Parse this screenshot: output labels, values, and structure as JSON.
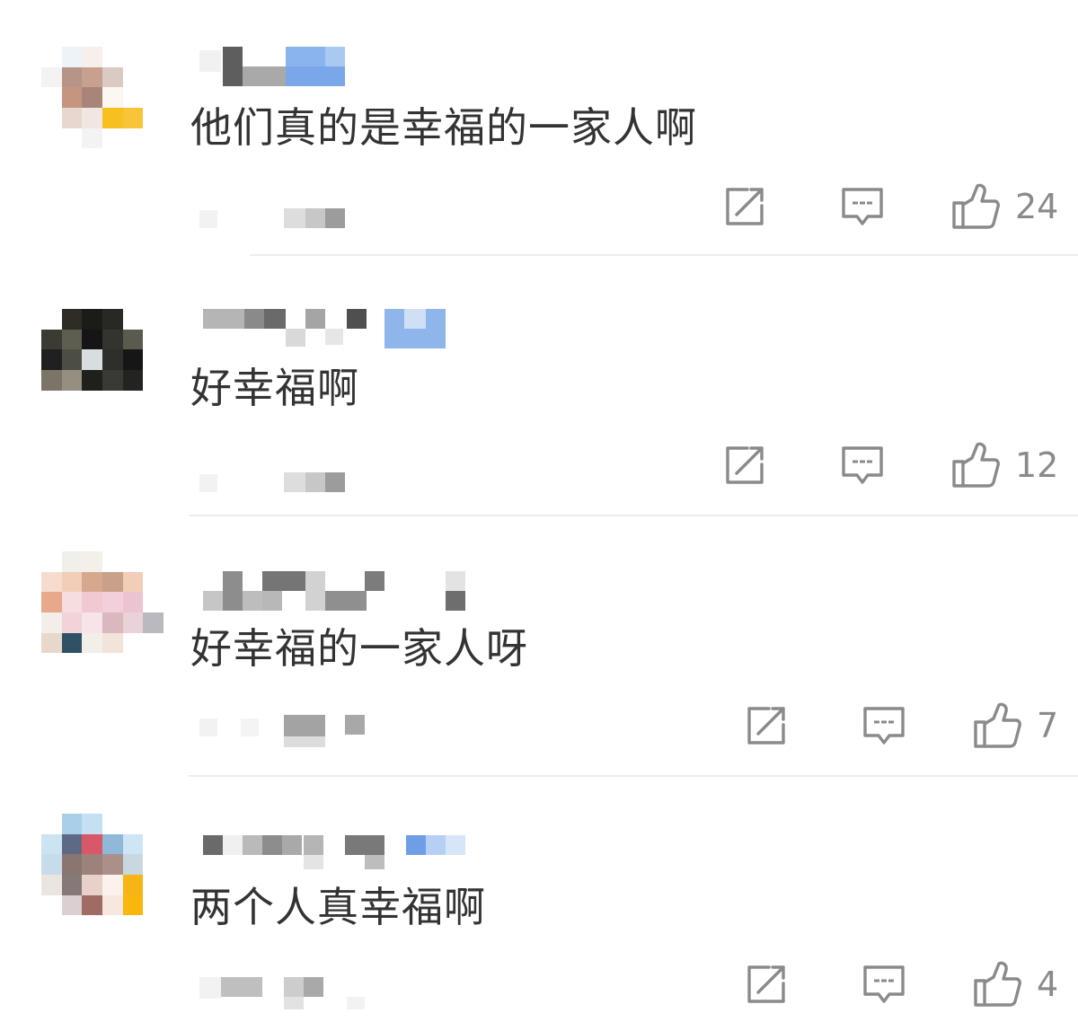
{
  "comments": [
    {
      "text": "他们真的是幸福的一家人啊",
      "likes": "24",
      "avatar_colors": [
        "#ffffff",
        "#eef3f8",
        "#f6efec",
        "#ffffff",
        "#ffffff",
        "#ffffff",
        "#f4f2f2",
        "#b69488",
        "#c7a08f",
        "#d9cbc4",
        "#ffffff",
        "#ffffff",
        "#ffffff",
        "#c69580",
        "#a98478",
        "#fdf7f1",
        "#ffffff",
        "#ffffff",
        "#ffffff",
        "#e7d7cf",
        "#f0e7e3",
        "#f5c020",
        "#f8c53a",
        "#ffffff",
        "#ffffff",
        "#ffffff",
        "#f3f3f3",
        "#ffffff",
        "#ffffff",
        "#ffffff",
        "#ffffff",
        "#ffffff",
        "#ffffff",
        "#ffffff",
        "#ffffff",
        "#ffffff"
      ]
    },
    {
      "text": "好幸福啊",
      "likes": "12",
      "avatar_colors": [
        "#ffffff",
        "#2f2c26",
        "#1d1b18",
        "#2a2824",
        "#ffffff",
        "#ffffff",
        "#3b3a33",
        "#5d5e50",
        "#151515",
        "#333330",
        "#5a5a4e",
        "#ffffff",
        "#202020",
        "#4c4d43",
        "#d8dde0",
        "#2e2e2b",
        "#161616",
        "#ffffff",
        "#7a7566",
        "#948f80",
        "#1f1f1c",
        "#3a3934",
        "#232321",
        "#ffffff",
        "#ffffff",
        "#ffffff",
        "#ffffff",
        "#ffffff",
        "#ffffff",
        "#ffffff",
        "#ffffff",
        "#ffffff",
        "#ffffff",
        "#ffffff",
        "#ffffff",
        "#ffffff"
      ]
    },
    {
      "text": "好幸福的一家人呀",
      "likes": "7",
      "avatar_colors": [
        "#ffffff",
        "#f1efe9",
        "#f3f0ea",
        "#ffffff",
        "#ffffff",
        "#ffffff",
        "#f7dccd",
        "#f2cdb7",
        "#d6a98f",
        "#c9a08a",
        "#f2cdb8",
        "#ffffff",
        "#e8a88a",
        "#f6dde0",
        "#f1c9d3",
        "#f3cfdc",
        "#ecc3d1",
        "#ffffff",
        "#f4eeea",
        "#f1d3d9",
        "#f6e4e9",
        "#d9b9bd",
        "#ead2d8",
        "#b9b9bf",
        "#e8d8cc",
        "#2e5163",
        "#f2efe9",
        "#f2e4d9",
        "#ffffff",
        "#ffffff",
        "#ffffff",
        "#ffffff",
        "#ffffff",
        "#ffffff",
        "#ffffff",
        "#ffffff"
      ]
    },
    {
      "text": "两个人真幸福啊",
      "likes": "4",
      "avatar_colors": [
        "#ffffff",
        "#a9cfe9",
        "#c4e0f2",
        "#ffffff",
        "#ffffff",
        "#ffffff",
        "#cce3f1",
        "#5d6a86",
        "#d85868",
        "#8fb8d9",
        "#cde5f4",
        "#ffffff",
        "#c7dcea",
        "#8a7570",
        "#9b837c",
        "#a99088",
        "#c9d7e1",
        "#ffffff",
        "#ebe5e0",
        "#857876",
        "#e7d1c8",
        "#fbf2ed",
        "#f6b515",
        "#ffffff",
        "#ffffff",
        "#d9d0d2",
        "#a06b62",
        "#f7e7df",
        "#f9b60d",
        "#ffffff",
        "#ffffff",
        "#ffffff",
        "#ffffff",
        "#ffffff",
        "#ffffff",
        "#ffffff"
      ]
    }
  ],
  "icons": {
    "share": "share-icon",
    "reply": "comment-icon",
    "like": "thumbs-up-icon"
  },
  "colors": {
    "text": "#333333",
    "icon": "#8a8a8a",
    "divider": "#ececec"
  }
}
